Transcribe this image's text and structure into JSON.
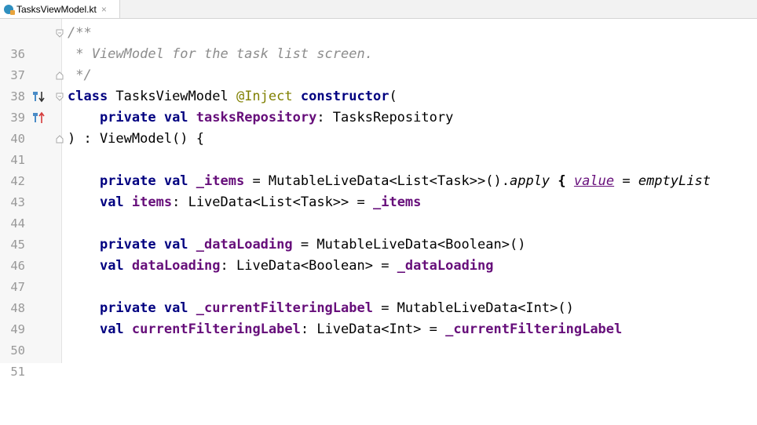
{
  "tab": {
    "file_name": "TasksViewModel.kt",
    "close_glyph": "×"
  },
  "lines": [
    {
      "num": "36",
      "t": [
        "/**"
      ]
    },
    {
      "num": "37",
      "t": [
        " * ViewModel for the task list screen."
      ]
    },
    {
      "num": "38",
      "t": [
        " */"
      ]
    },
    {
      "num": "39",
      "t": [
        "class",
        " TasksViewModel ",
        "@Inject",
        " ",
        "constructor",
        "("
      ]
    },
    {
      "num": "40",
      "t": [
        "    ",
        "private val",
        " ",
        "tasksRepository",
        ": TasksRepository"
      ]
    },
    {
      "num": "41",
      "t": [
        ") : ViewModel() {"
      ]
    },
    {
      "num": "42",
      "t": [
        ""
      ]
    },
    {
      "num": "43",
      "t": [
        "    ",
        "private val",
        " ",
        "_items",
        " = MutableLiveData<List<Task>>().",
        "apply",
        " ",
        "{",
        " ",
        "value",
        " = ",
        "emptyList"
      ]
    },
    {
      "num": "44",
      "t": [
        "    ",
        "val",
        " ",
        "items",
        ": LiveData<List<Task>> = ",
        "_items"
      ]
    },
    {
      "num": "45",
      "t": [
        ""
      ]
    },
    {
      "num": "46",
      "t": [
        "    ",
        "private val",
        " ",
        "_dataLoading",
        " = MutableLiveData<Boolean>()"
      ]
    },
    {
      "num": "47",
      "t": [
        "    ",
        "val",
        " ",
        "dataLoading",
        ": LiveData<Boolean> = ",
        "_dataLoading"
      ]
    },
    {
      "num": "48",
      "t": [
        ""
      ]
    },
    {
      "num": "49",
      "t": [
        "    ",
        "private val",
        " ",
        "_currentFilteringLabel",
        " = MutableLiveData<Int>()"
      ]
    },
    {
      "num": "50",
      "t": [
        "    ",
        "val",
        " ",
        "currentFilteringLabel",
        ": LiveData<Int> = ",
        "_currentFilteringLabel"
      ]
    },
    {
      "num": "51",
      "t": [
        ""
      ]
    }
  ],
  "colors": {
    "keyword": "#000080",
    "property": "#660e7a",
    "annotation": "#808000",
    "comment": "#8c8c8c",
    "line_number": "#999999"
  }
}
